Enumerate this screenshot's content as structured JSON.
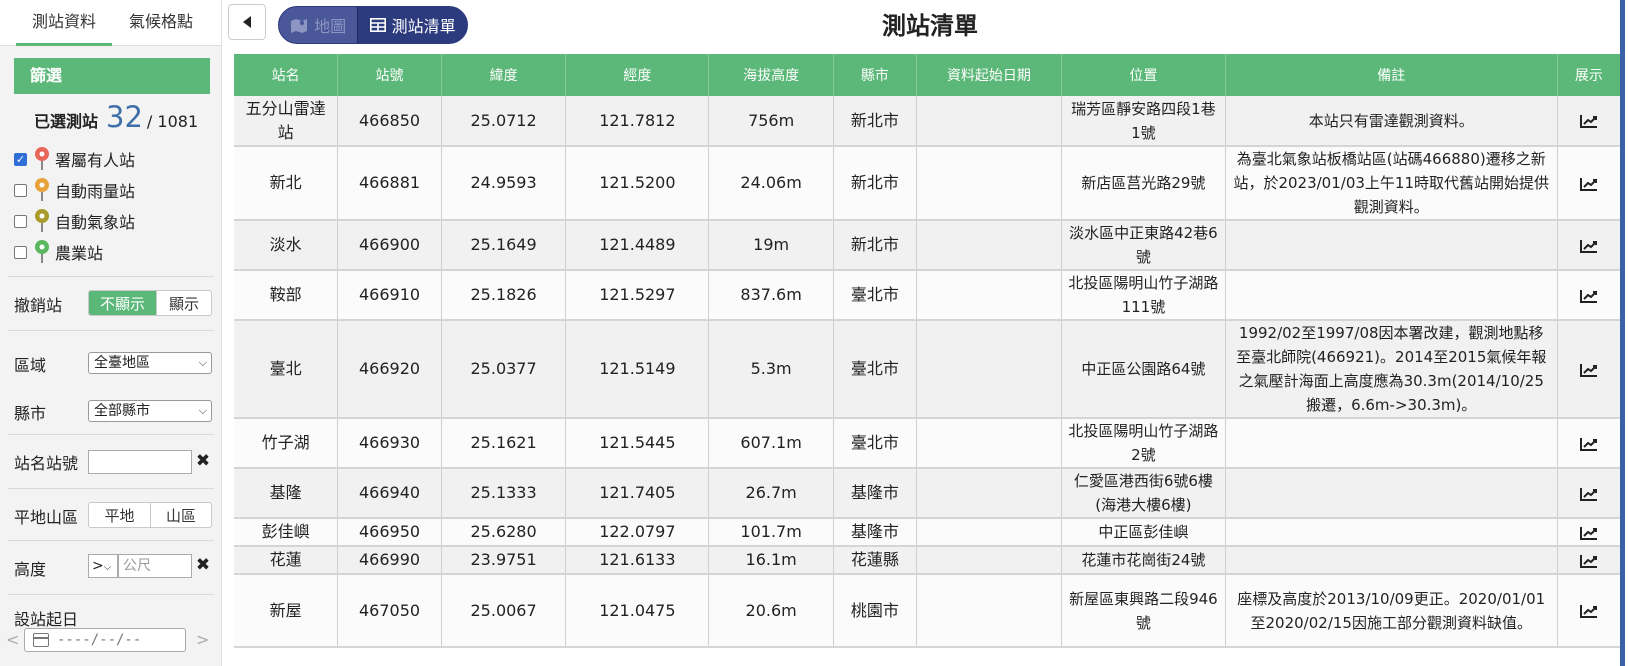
{
  "sidebar": {
    "tabs": [
      "測站資料",
      "氣候格點"
    ],
    "filter_title": "篩選",
    "selected_label": "已選測站",
    "selected_count": "32",
    "selected_total": "/ 1081",
    "station_types": [
      {
        "label": "署屬有人站",
        "checked": true,
        "color": "#e8675a",
        "icon": "red-pin-icon"
      },
      {
        "label": "自動雨量站",
        "checked": false,
        "color": "#e8a23a",
        "icon": "orange-pin-icon"
      },
      {
        "label": "自動氣象站",
        "checked": false,
        "color": "#a99b2c",
        "icon": "olive-pin-icon"
      },
      {
        "label": "農業站",
        "checked": false,
        "color": "#5bb85f",
        "icon": "green-pin-icon"
      }
    ],
    "revoked": {
      "label": "撤銷站",
      "options": [
        "不顯示",
        "顯示"
      ],
      "active": "不顯示"
    },
    "region": {
      "label": "區域",
      "value": "全臺地區"
    },
    "county": {
      "label": "縣市",
      "value": "全部縣市"
    },
    "name_id": {
      "label": "站名站號",
      "value": ""
    },
    "terrain": {
      "label": "平地山區",
      "options": [
        "平地",
        "山區"
      ]
    },
    "altitude": {
      "label": "高度",
      "operator": ">",
      "placeholder": "公尺"
    },
    "start_date": {
      "label": "設站起日",
      "placeholder": "----/--/--"
    }
  },
  "header": {
    "title": "測站清單",
    "view_map": "地圖",
    "view_list": "測站清單"
  },
  "table": {
    "columns": [
      "站名",
      "站號",
      "緯度",
      "經度",
      "海拔高度",
      "縣市",
      "資料起始日期",
      "位置",
      "備註",
      "展示"
    ],
    "rows": [
      {
        "name": "五分山雷達站",
        "id": "466850",
        "lat": "25.0712",
        "lon": "121.7812",
        "alt": "756m",
        "county": "新北市",
        "start": "",
        "loc": "瑞芳區靜安路四段1巷1號",
        "note": "本站只有雷達觀測資料。"
      },
      {
        "name": "新北",
        "id": "466881",
        "lat": "24.9593",
        "lon": "121.5200",
        "alt": "24.06m",
        "county": "新北市",
        "start": "",
        "loc": "新店區莒光路29號",
        "note": "為臺北氣象站板橋站區(站碼466880)遷移之新站，於2023/01/03上午11時取代舊站開始提供觀測資料。"
      },
      {
        "name": "淡水",
        "id": "466900",
        "lat": "25.1649",
        "lon": "121.4489",
        "alt": "19m",
        "county": "新北市",
        "start": "",
        "loc": "淡水區中正東路42巷6號",
        "note": ""
      },
      {
        "name": "鞍部",
        "id": "466910",
        "lat": "25.1826",
        "lon": "121.5297",
        "alt": "837.6m",
        "county": "臺北市",
        "start": "",
        "loc": "北投區陽明山竹子湖路111號",
        "note": ""
      },
      {
        "name": "臺北",
        "id": "466920",
        "lat": "25.0377",
        "lon": "121.5149",
        "alt": "5.3m",
        "county": "臺北市",
        "start": "",
        "loc": "中正區公園路64號",
        "note": "1992/02至1997/08因本署改建，觀測地點移至臺北師院(466921)。2014至2015氣候年報之氣壓計海面上高度應為30.3m(2014/10/25搬遷，6.6m->30.3m)。"
      },
      {
        "name": "竹子湖",
        "id": "466930",
        "lat": "25.1621",
        "lon": "121.5445",
        "alt": "607.1m",
        "county": "臺北市",
        "start": "",
        "loc": "北投區陽明山竹子湖路2號",
        "note": ""
      },
      {
        "name": "基隆",
        "id": "466940",
        "lat": "25.1333",
        "lon": "121.7405",
        "alt": "26.7m",
        "county": "基隆市",
        "start": "",
        "loc": "仁愛區港西街6號6樓(海港大樓6樓)",
        "note": ""
      },
      {
        "name": "彭佳嶼",
        "id": "466950",
        "lat": "25.6280",
        "lon": "122.0797",
        "alt": "101.7m",
        "county": "基隆市",
        "start": "",
        "loc": "中正區彭佳嶼",
        "note": ""
      },
      {
        "name": "花蓮",
        "id": "466990",
        "lat": "23.9751",
        "lon": "121.6133",
        "alt": "16.1m",
        "county": "花蓮縣",
        "start": "",
        "loc": "花蓮市花崗街24號",
        "note": ""
      },
      {
        "name": "新屋",
        "id": "467050",
        "lat": "25.0067",
        "lon": "121.0475",
        "alt": "20.6m",
        "county": "桃園市",
        "start": "",
        "loc": "新屋區東興路二段946號",
        "note": "座標及高度於2013/10/09更正。2020/01/01至2020/02/15因施工部分觀測資料缺值。"
      }
    ]
  },
  "colors": {
    "green": "#5bb878",
    "navy": "#2c3a7e",
    "count_blue": "#3e6fa8"
  }
}
